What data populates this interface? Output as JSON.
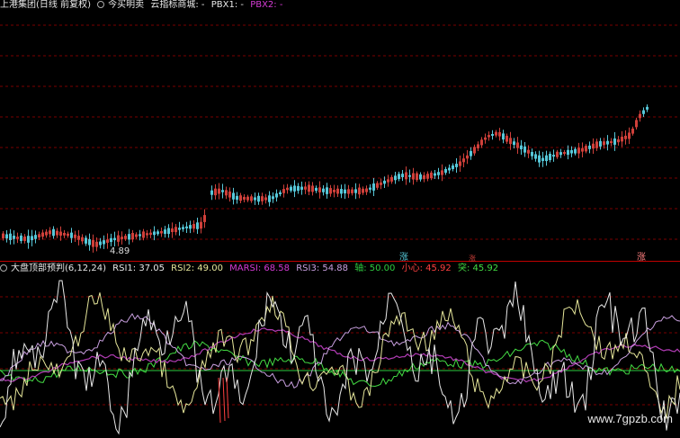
{
  "colors": {
    "background": "#000000",
    "grid": "#7a0000",
    "divider": "#c00000",
    "candle_up": "#d0403a",
    "candle_down": "#56c7d8",
    "white": "#e8e8e8",
    "rsi2": "#e6e69a",
    "marsi": "#b23cb5",
    "rsi3": "#c9a0e0",
    "axis": "#2ecc40",
    "xiaoxin": "#ff4040",
    "tu": "#44dd44"
  },
  "top_header": {
    "stock": "上港集团(日线 前复权)",
    "indicator_name": "今买明卖",
    "mall": "云指标商城",
    "mall_value": "-",
    "pbx1_label": "PBX1:",
    "pbx1_value": "-",
    "pbx2_label": "PBX2:",
    "pbx2_value": "-"
  },
  "price_label": "4.89",
  "signals": {
    "left": "涨",
    "mid": "涨",
    "right": "涨"
  },
  "indicator_header": {
    "name": "大盘顶部预判(6,12,24)",
    "rsi1": "RSI1: 37.05",
    "rsi2": "RSI2: 49.00",
    "marsi": "MARSI: 68.58",
    "rsi3": "RSI3: 54.88",
    "axis": "轴: 50.00",
    "xiaoxin": "小心: 45.92",
    "tu": "突: 45.92"
  },
  "watermark": "www.7gpzb.com"
}
